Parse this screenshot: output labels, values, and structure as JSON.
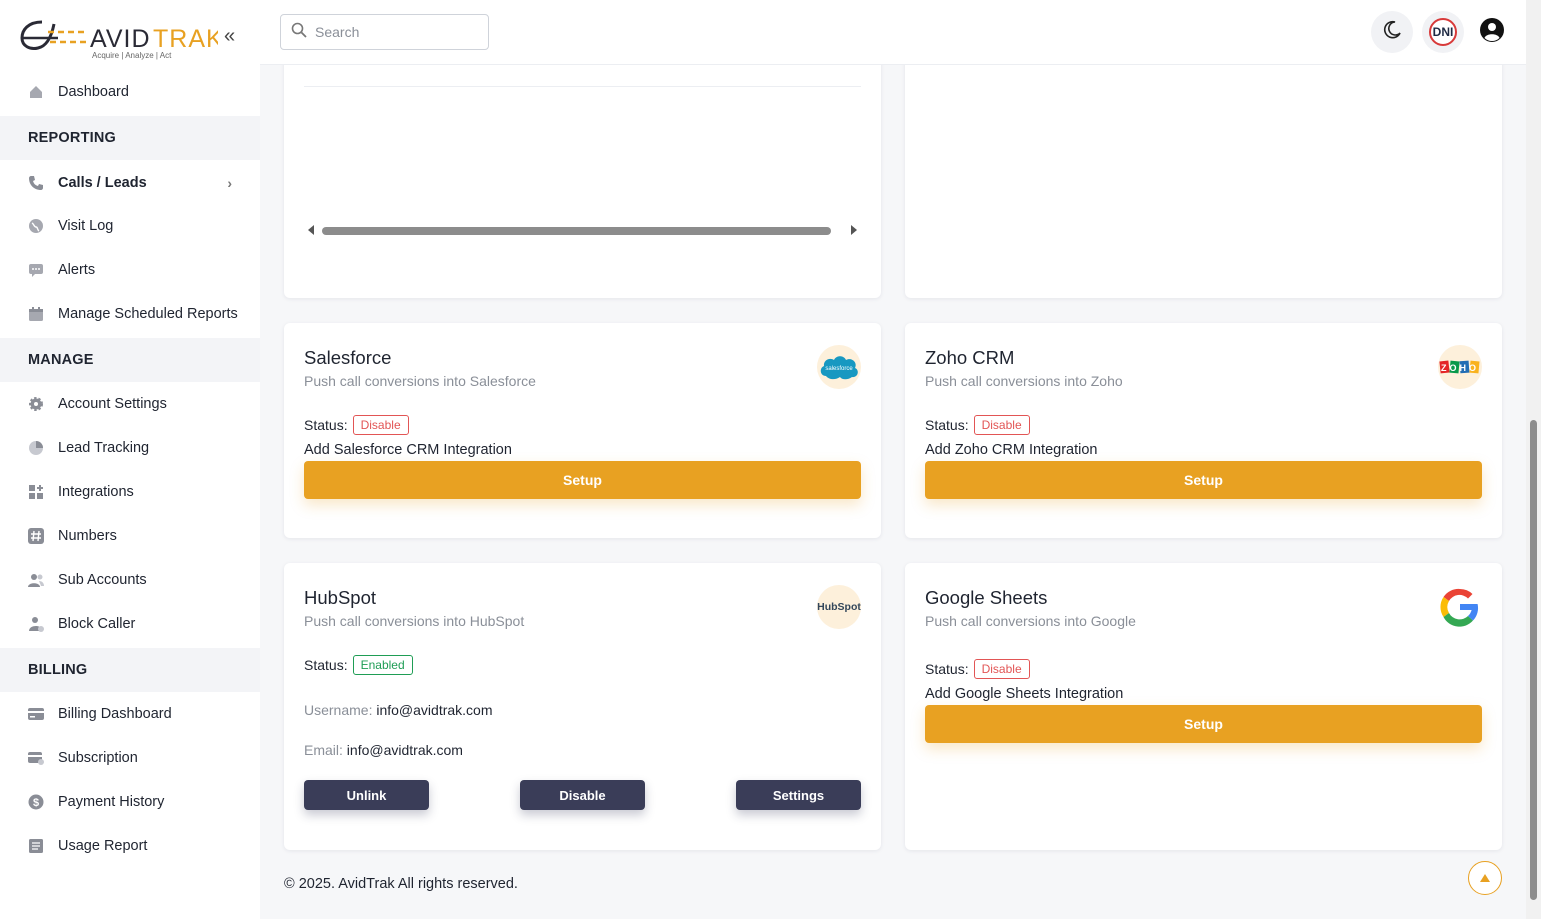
{
  "brand": {
    "name": "AVIDTRAK",
    "tagline": "Acquire  |  Analyze  |  Act"
  },
  "sidebar": {
    "collapse_icon": "double-chevron-left-icon",
    "dashboard": "Dashboard",
    "sections": {
      "reporting": "REPORTING",
      "manage": "MANAGE",
      "billing": "BILLING"
    },
    "reporting_items": [
      {
        "label": "Calls / Leads",
        "icon": "phone-icon"
      },
      {
        "label": "Visit Log",
        "icon": "globe-icon"
      },
      {
        "label": "Alerts",
        "icon": "chat-icon"
      },
      {
        "label": "Manage Scheduled Reports",
        "icon": "calendar-icon"
      }
    ],
    "manage_items": [
      {
        "label": "Account Settings",
        "icon": "gear-icon"
      },
      {
        "label": "Lead Tracking",
        "icon": "pie-chart-icon"
      },
      {
        "label": "Integrations",
        "icon": "grid-plus-icon"
      },
      {
        "label": "Numbers",
        "icon": "hash-icon"
      },
      {
        "label": "Sub Accounts",
        "icon": "users-icon"
      },
      {
        "label": "Block Caller",
        "icon": "user-block-icon"
      }
    ],
    "billing_items": [
      {
        "label": "Billing Dashboard",
        "icon": "credit-card-icon"
      },
      {
        "label": "Subscription",
        "icon": "card-refresh-icon"
      },
      {
        "label": "Payment History",
        "icon": "dollar-icon"
      },
      {
        "label": "Usage Report",
        "icon": "report-icon"
      }
    ]
  },
  "header": {
    "search_placeholder": "Search",
    "dni_label": "DNI"
  },
  "integrations": {
    "salesforce": {
      "title": "Salesforce",
      "subtitle": "Push call conversions into Salesforce",
      "status_label": "Status:",
      "status": "Disable",
      "add_text": "Add Salesforce CRM Integration",
      "setup": "Setup",
      "logo_text": "salesforce"
    },
    "zoho": {
      "title": "Zoho CRM",
      "subtitle": "Push call conversions into Zoho",
      "status_label": "Status:",
      "status": "Disable",
      "add_text": "Add Zoho CRM Integration",
      "setup": "Setup",
      "logo_text": "ZOHO"
    },
    "hubspot": {
      "title": "HubSpot",
      "subtitle": "Push call conversions into HubSpot",
      "status_label": "Status:",
      "status": "Enabled",
      "username_label": "Username:",
      "username": "info@avidtrak.com",
      "email_label": "Email:",
      "email": "info@avidtrak.com",
      "unlink": "Unlink",
      "disable": "Disable",
      "settings": "Settings",
      "logo_text": "HubSpot"
    },
    "google_sheets": {
      "title": "Google Sheets",
      "subtitle": "Push call conversions into Google",
      "status_label": "Status:",
      "status": "Disable",
      "add_text": "Add Google Sheets Integration",
      "setup": "Setup"
    }
  },
  "footer": {
    "copyright": "© 2025. AvidTrak All rights reserved."
  },
  "colors": {
    "accent": "#e8a122",
    "dark_button": "#3a3d58",
    "disable": "#e25555",
    "enabled": "#1f9d55"
  }
}
